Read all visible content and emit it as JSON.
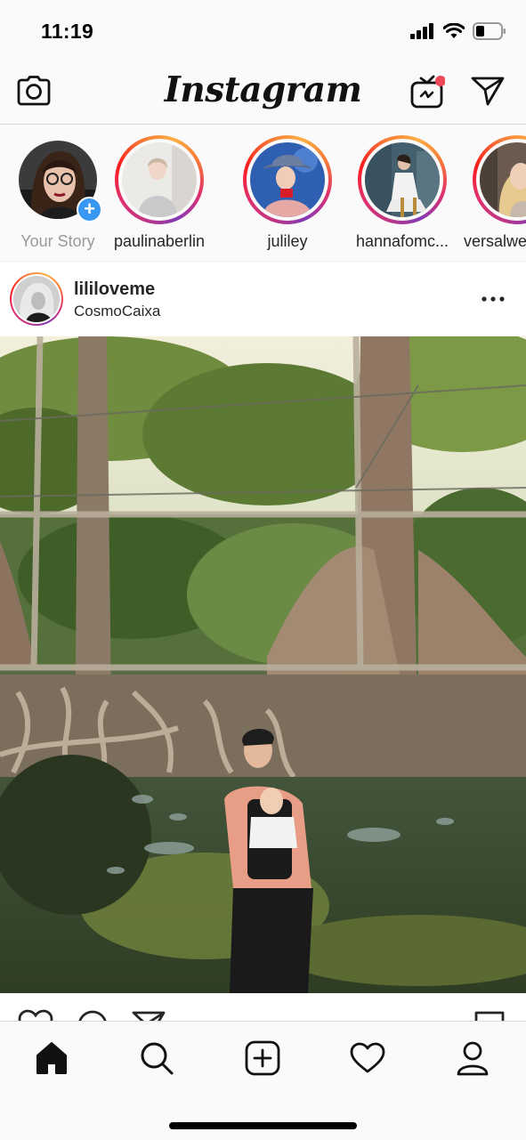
{
  "status_bar": {
    "time": "11:19",
    "icons": [
      "signal-icon",
      "wifi-icon",
      "battery-icon"
    ]
  },
  "top_nav": {
    "logo_text": "Instagram",
    "left_icon": "camera-icon",
    "right_icons": [
      "igtv-icon",
      "direct-message-icon"
    ],
    "notification_dot_color": "#ed4956"
  },
  "stories": [
    {
      "label": "Your Story",
      "own": true
    },
    {
      "label": "paulinaberlin",
      "own": false
    },
    {
      "label": "juliley",
      "own": false
    },
    {
      "label": "hannafomc...",
      "own": false
    },
    {
      "label": "versalwe",
      "own": false
    }
  ],
  "post": {
    "username": "lililoveme",
    "location": "CosmoCaixa",
    "more_icon": "more-options-icon"
  },
  "tab_bar": {
    "tabs": [
      "home-icon",
      "search-icon",
      "new-post-icon",
      "activity-heart-icon",
      "profile-icon"
    ]
  },
  "colors": {
    "accent_blue": "#3897f0",
    "story_gradient": [
      "#833ab4",
      "#e1306c",
      "#fd1d1d",
      "#f77737",
      "#fcaf45"
    ]
  }
}
